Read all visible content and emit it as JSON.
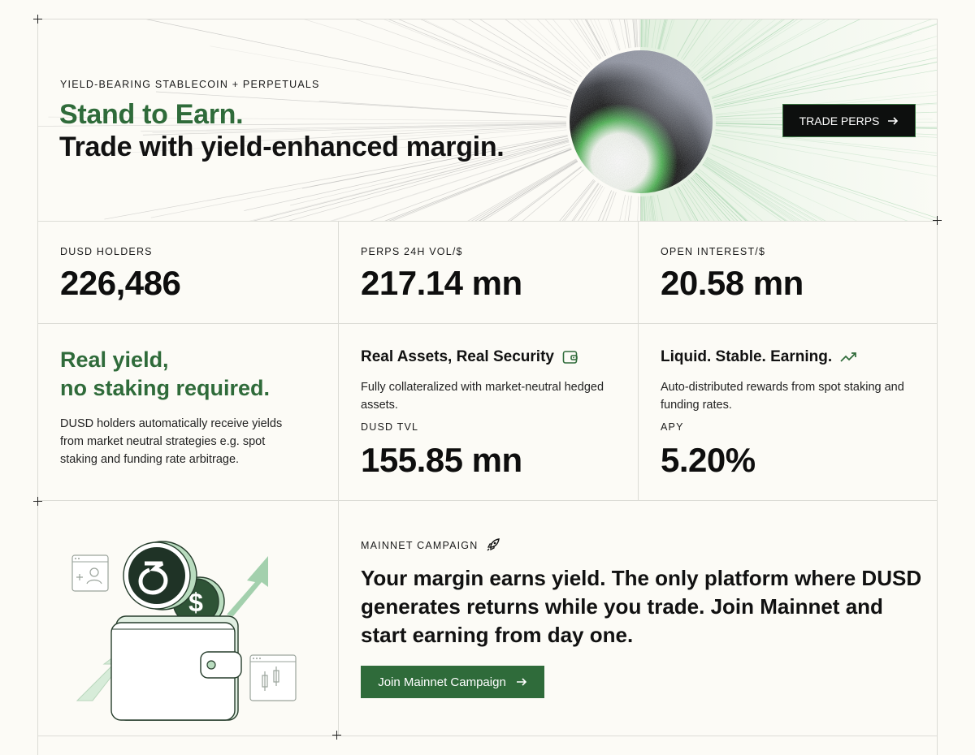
{
  "hero": {
    "eyebrow": "YIELD-BEARING STABLECOIN + PERPETUALS",
    "title_line1": "Stand to Earn.",
    "title_line2": "Trade with yield-enhanced margin.",
    "cta_label": "TRADE PERPS",
    "cta_icon": "arrow-right-icon"
  },
  "stats": [
    {
      "label": "DUSD HOLDERS",
      "value": "226,486"
    },
    {
      "label": "PERPS 24H VOL/$",
      "value": "217.14 mn"
    },
    {
      "label": "OPEN INTEREST/$",
      "value": "20.58 mn"
    }
  ],
  "features": {
    "yield": {
      "heading_line1": "Real yield,",
      "heading_line2": "no staking required.",
      "description": "DUSD holders automatically receive yields from market neutral strategies e.g. spot staking and funding rate arbitrage."
    },
    "assets": {
      "title": "Real Assets, Real Security",
      "icon": "wallet-icon",
      "description": "Fully collateralized with market-neutral hedged assets.",
      "metric_label": "DUSD TVL",
      "metric_value": "155.85 mn"
    },
    "liquid": {
      "title": "Liquid. Stable. Earning.",
      "icon": "trend-up-icon",
      "description": "Auto-distributed rewards from spot staking and funding rates.",
      "metric_label": "APY",
      "metric_value": "5.20%"
    }
  },
  "campaign": {
    "label": "MAINNET CAMPAIGN",
    "icon": "rocket-icon",
    "headline": "Your margin earns yield. The only platform where DUSD generates returns while you trade. Join Mainnet and start earning from day one.",
    "cta_label": "Join Mainnet Campaign",
    "illustration_coin_symbol": "$"
  },
  "colors": {
    "brand_green": "#2f6b3a",
    "dark": "#0d0f0e",
    "background": "#fcfbf6"
  }
}
